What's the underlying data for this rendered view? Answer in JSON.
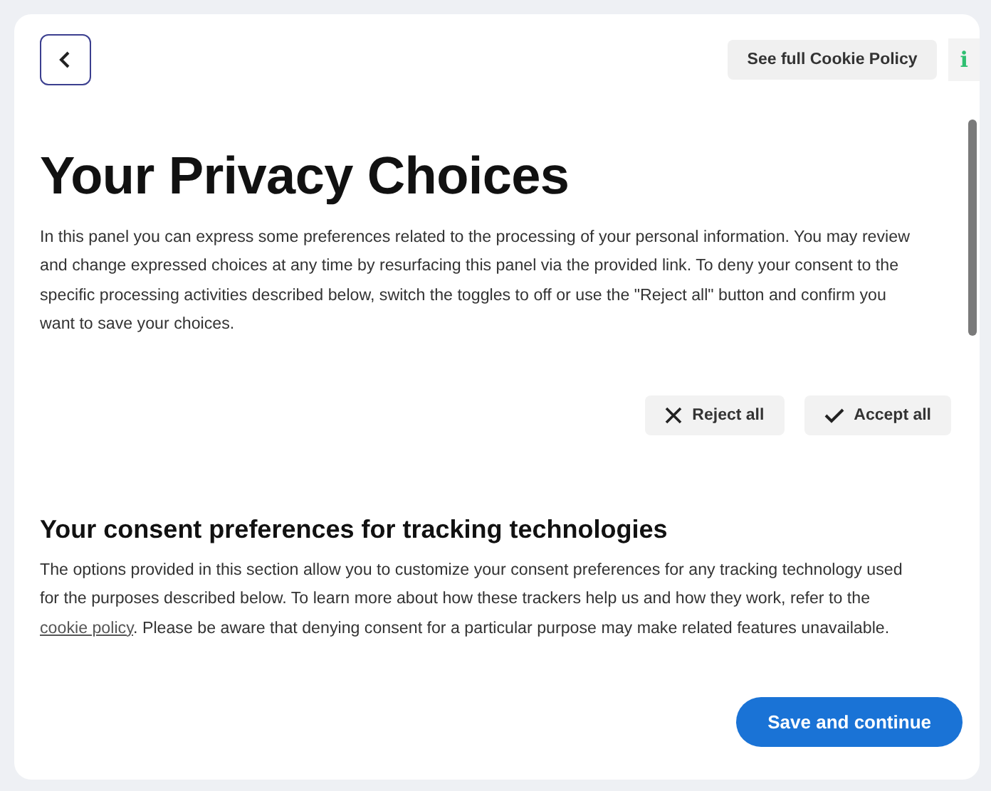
{
  "header": {
    "policy_button": "See full Cookie Policy",
    "info_label": "i"
  },
  "title": "Your Privacy Choices",
  "intro": "In this panel you can express some preferences related to the processing of your personal information. You may review and change expressed choices at any time by resurfacing this panel via the provided link. To deny your consent to the specific processing activities described below, switch the toggles to off or use the \"Reject all\" button and confirm you want to save your choices.",
  "actions": [
    {
      "kind": "reject",
      "label": "Reject all"
    },
    {
      "kind": "accept",
      "label": "Accept all"
    }
  ],
  "section": {
    "heading": "Your consent preferences for tracking technologies",
    "text_before": "The options provided in this section allow you to customize your consent preferences for any tracking technology used for the purposes described below. To learn more about how these trackers help us and how they work, refer to the",
    "link": "cookie policy",
    "text_after": ". Please be aware that denying consent for a particular purpose may make related features unavailable."
  },
  "save_button": "Save and continue"
}
